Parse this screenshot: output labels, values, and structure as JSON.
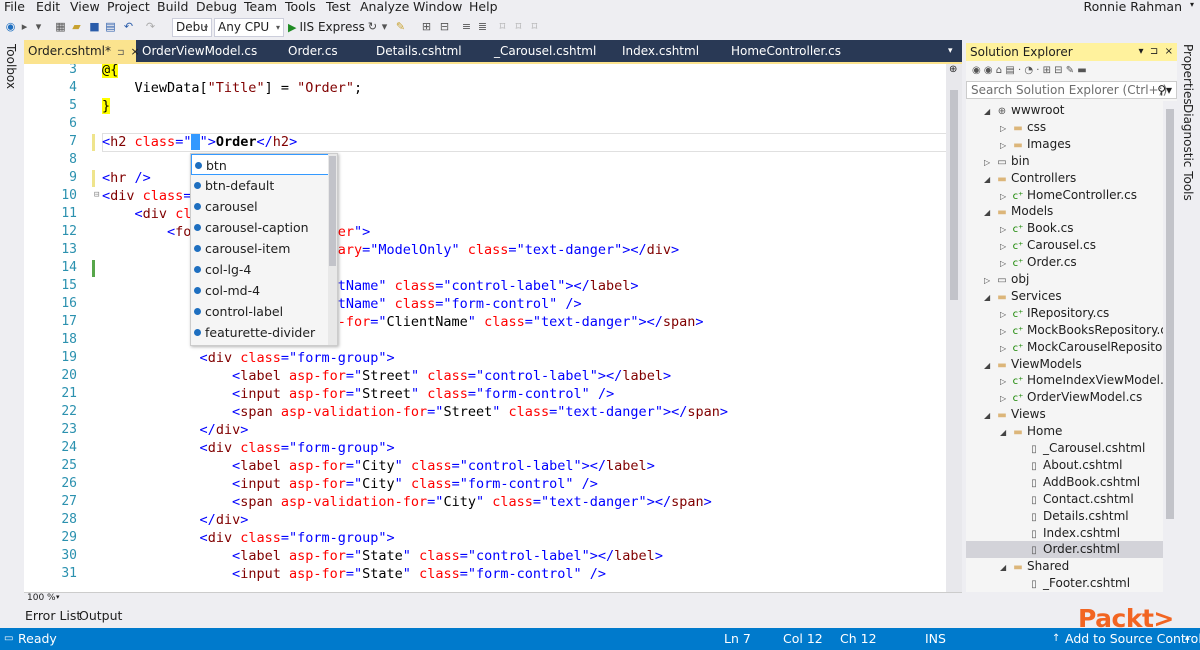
{
  "menu": {
    "items": [
      "File",
      "Edit",
      "View",
      "Project",
      "Build",
      "Debug",
      "Team",
      "Tools",
      "Test",
      "Analyze",
      "Window",
      "Help"
    ],
    "user": "Ronnie Rahman"
  },
  "toolbar": {
    "config": "Debu",
    "platform": "Any CPU",
    "run_target": "IIS Express"
  },
  "left_strip": {
    "toolbox_label": "Toolbox"
  },
  "right_strip": {
    "properties_label": "Properties",
    "diagnostic_label": "Diagnostic Tools"
  },
  "tabs": [
    {
      "label": "Order.cshtml*",
      "active": true
    },
    {
      "label": "OrderViewModel.cs"
    },
    {
      "label": "Order.cs"
    },
    {
      "label": "Details.cshtml"
    },
    {
      "label": "_Carousel.cshtml"
    },
    {
      "label": "Index.cshtml"
    },
    {
      "label": "HomeController.cs"
    }
  ],
  "editor": {
    "line_numbers": [
      "3",
      "4",
      "5",
      "6",
      "7",
      "8",
      "9",
      "10",
      "11",
      "12",
      "13",
      "14",
      "15",
      "16",
      "17",
      "18",
      "19",
      "20",
      "21",
      "22",
      "23",
      "24",
      "25",
      "26",
      "27",
      "28",
      "29",
      "30",
      "31"
    ],
    "zoom": "100 %"
  },
  "intellisense": {
    "items": [
      "btn",
      "btn-default",
      "carousel",
      "carousel-caption",
      "carousel-item",
      "col-lg-4",
      "col-md-4",
      "control-label",
      "featurette-divider"
    ],
    "selected": "btn"
  },
  "bottom_tabs": {
    "error_list": "Error List",
    "output": "Output"
  },
  "solution_explorer": {
    "title": "Solution Explorer",
    "search_placeholder": "Search Solution Explorer (Ctrl+;)",
    "tree": [
      {
        "label": "wwwroot",
        "level": 0,
        "kind": "globe",
        "expanded": true
      },
      {
        "label": "css",
        "level": 1,
        "kind": "folder",
        "expanded": false
      },
      {
        "label": "Images",
        "level": 1,
        "kind": "folder",
        "expanded": false
      },
      {
        "label": "bin",
        "level": 0,
        "kind": "folder-empty",
        "expanded": false
      },
      {
        "label": "Controllers",
        "level": 0,
        "kind": "folder",
        "expanded": true
      },
      {
        "label": "HomeController.cs",
        "level": 1,
        "kind": "cs",
        "expanded": false
      },
      {
        "label": "Models",
        "level": 0,
        "kind": "folder",
        "expanded": true
      },
      {
        "label": "Book.cs",
        "level": 1,
        "kind": "cs",
        "expanded": false
      },
      {
        "label": "Carousel.cs",
        "level": 1,
        "kind": "cs",
        "expanded": false
      },
      {
        "label": "Order.cs",
        "level": 1,
        "kind": "cs",
        "expanded": false
      },
      {
        "label": "obj",
        "level": 0,
        "kind": "folder-empty",
        "expanded": false
      },
      {
        "label": "Services",
        "level": 0,
        "kind": "folder",
        "expanded": true
      },
      {
        "label": "IRepository.cs",
        "level": 1,
        "kind": "cs",
        "expanded": false
      },
      {
        "label": "MockBooksRepository.cs",
        "level": 1,
        "kind": "cs",
        "expanded": false
      },
      {
        "label": "MockCarouselRepository.cs",
        "level": 1,
        "kind": "cs",
        "expanded": false
      },
      {
        "label": "ViewModels",
        "level": 0,
        "kind": "folder",
        "expanded": true
      },
      {
        "label": "HomeIndexViewModel.cs",
        "level": 1,
        "kind": "cs",
        "expanded": false
      },
      {
        "label": "OrderViewModel.cs",
        "level": 1,
        "kind": "cs",
        "expanded": false
      },
      {
        "label": "Views",
        "level": 0,
        "kind": "folder",
        "expanded": true
      },
      {
        "label": "Home",
        "level": 1,
        "kind": "folder",
        "expanded": true
      },
      {
        "label": "_Carousel.cshtml",
        "level": 2,
        "kind": "file"
      },
      {
        "label": "About.cshtml",
        "level": 2,
        "kind": "file"
      },
      {
        "label": "AddBook.cshtml",
        "level": 2,
        "kind": "file"
      },
      {
        "label": "Contact.cshtml",
        "level": 2,
        "kind": "file"
      },
      {
        "label": "Details.cshtml",
        "level": 2,
        "kind": "file"
      },
      {
        "label": "Index.cshtml",
        "level": 2,
        "kind": "file"
      },
      {
        "label": "Order.cshtml",
        "level": 2,
        "kind": "file",
        "selected": true
      },
      {
        "label": "Shared",
        "level": 1,
        "kind": "folder",
        "expanded": true
      },
      {
        "label": "_Footer.cshtml",
        "level": 2,
        "kind": "file"
      }
    ]
  },
  "status": {
    "ready": "Ready",
    "ln": "Ln 7",
    "col": "Col 12",
    "ch": "Ch 12",
    "ins": "INS",
    "source_control": "Add to Source Control"
  },
  "logo": {
    "text": "Packt>"
  },
  "colors": {
    "status_bar": "#007acc",
    "tab_strip": "#293955",
    "active_tab": "#fbe38e",
    "logo": "#f26522"
  }
}
